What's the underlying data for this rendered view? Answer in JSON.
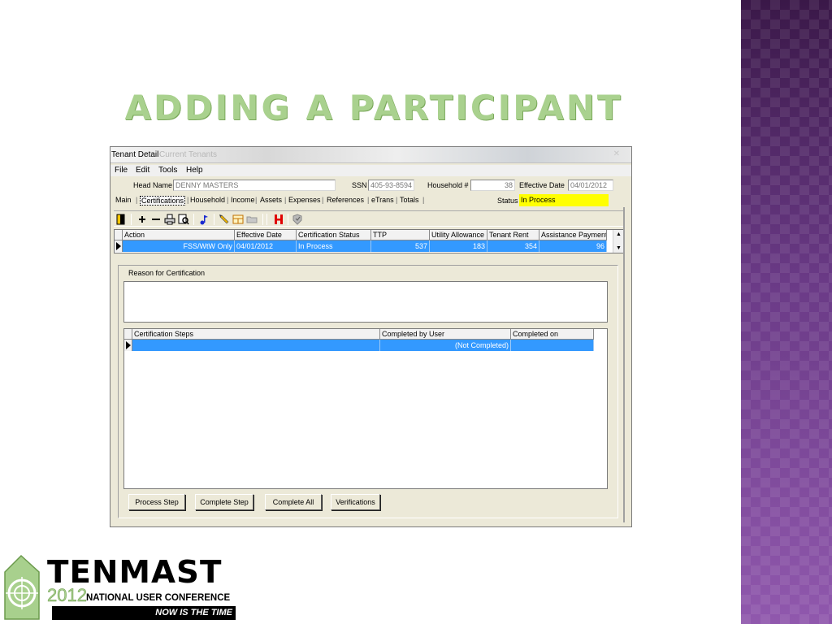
{
  "slide": {
    "title": "ADDING A PARTICIPANT",
    "accent_color": "#a9d18e",
    "band_color": "#6a3a86"
  },
  "window": {
    "title": "Tenant Detail",
    "title_ghost": "Current Tenants"
  },
  "menu": [
    "File",
    "Edit",
    "Tools",
    "Help"
  ],
  "header": {
    "head_name_label": "Head Name",
    "head_name_value": "DENNY MASTERS",
    "ssn_label": "SSN",
    "ssn_value": "405-93-8594",
    "household_label": "Household #",
    "household_value": "38",
    "effective_date_label": "Effective Date",
    "effective_date_value": "04/01/2012",
    "status_label": "Status",
    "status_value": "In Process",
    "status_color": "#ffff00"
  },
  "tabs": [
    "Main",
    "Certifications",
    "Household",
    "Income",
    "Assets",
    "Expenses",
    "References",
    "eTrans",
    "Totals"
  ],
  "active_tab": "Certifications",
  "toolbar_icons": [
    "exit-door-icon",
    "add-icon",
    "remove-icon",
    "print-icon",
    "print-preview-icon",
    "music-note-icon",
    "pencil-icon",
    "form-icon",
    "folder-icon",
    "h-icon",
    "hud-icon"
  ],
  "cert_grid": {
    "columns": [
      "Action",
      "Effective Date",
      "Certification Status",
      "TTP",
      "Utility Allowance",
      "Tenant Rent",
      "Assistance Payment"
    ],
    "row": [
      "FSS/WtW Only",
      "04/01/2012",
      "In Process",
      "537",
      "183",
      "354",
      "96"
    ]
  },
  "reason": {
    "label": "Reason for Certification",
    "value": ""
  },
  "steps_grid": {
    "columns": [
      "Certification Steps",
      "Completed by User",
      "Completed on"
    ],
    "row": [
      "",
      "(Not Completed)",
      ""
    ]
  },
  "buttons": {
    "process_step": "Process Step",
    "complete_step": "Complete Step",
    "complete_all": "Complete All",
    "verifications": "Verifications"
  },
  "logo": {
    "brand": "TENMAST",
    "year": "2012",
    "conference": "NATIONAL USER CONFERENCE",
    "tagline": "NOW IS THE TIME",
    "green": "#a8d08d"
  }
}
